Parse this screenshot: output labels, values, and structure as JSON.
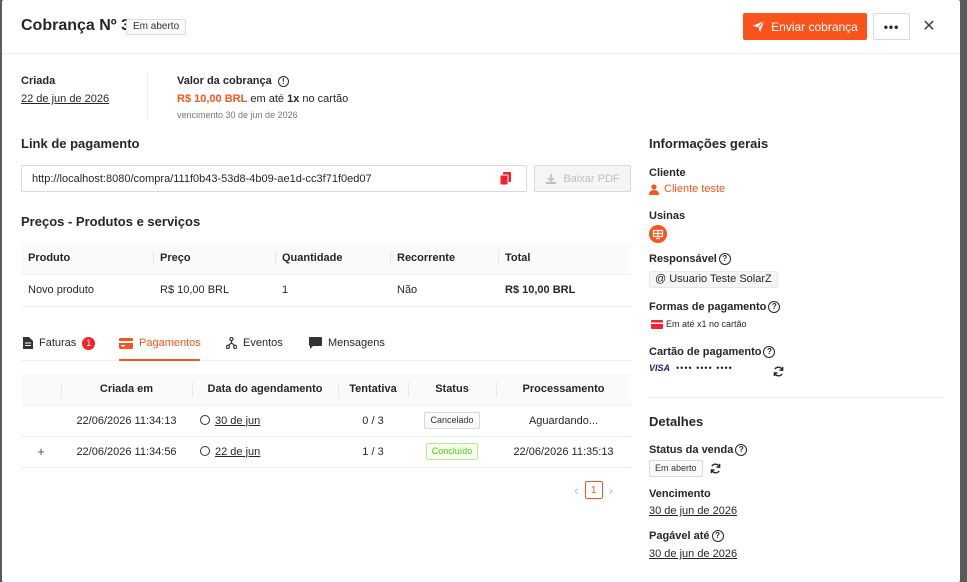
{
  "header": {
    "title": "Cobrança Nº 3",
    "status_badge": "Em aberto",
    "send_button": "Enviar cobrança",
    "more_button": "•••",
    "close_button": "✕"
  },
  "summary": {
    "created_label": "Criada",
    "created_date": "22 de jun de 2026",
    "value_label": "Valor da cobrança",
    "value_amount": "R$ 10,00 BRL",
    "value_mid": "em até",
    "value_installments": "1x",
    "value_suffix": "no cartão",
    "due_text": "vencimento 30 de jun de 2026"
  },
  "payment_link": {
    "title": "Link de pagamento",
    "url": "http://localhost:8080/compra/111f0b43-53d8-4b09-ae1d-cc3f71f0ed07",
    "pdf_button": "Baixar PDF"
  },
  "prices": {
    "title": "Preços - Produtos e serviços",
    "columns": [
      "Produto",
      "Preço",
      "Quantidade",
      "Recorrente",
      "Total"
    ],
    "rows": [
      [
        "Novo produto",
        "R$ 10,00 BRL",
        "1",
        "Não",
        "R$ 10,00 BRL"
      ]
    ]
  },
  "tabs": {
    "items": [
      {
        "label": "Faturas",
        "count": "1"
      },
      {
        "label": "Pagamentos"
      },
      {
        "label": "Eventos"
      },
      {
        "label": "Mensagens"
      }
    ],
    "active": "Pagamentos"
  },
  "payments": {
    "columns": [
      "Criada em",
      "Data do agendamento",
      "Tentativa",
      "Status",
      "Processamento"
    ],
    "rows": [
      {
        "expand": "",
        "created": "22/06/2026 11:34:13",
        "scheduled": "30 de jun",
        "attempt": "0 / 3",
        "status": "Cancelado",
        "processing": "Aguardando..."
      },
      {
        "expand": "+",
        "created": "22/06/2026 11:34:56",
        "scheduled": "22 de jun",
        "attempt": "1 / 3",
        "status": "Concluído",
        "processing": "22/06/2026 11:35:13"
      }
    ],
    "pager": {
      "prev": "‹",
      "current": "1",
      "next": "›"
    }
  },
  "info": {
    "title": "Informações gerais",
    "client_label": "Cliente",
    "client_value": "Cliente teste",
    "plants_label": "Usinas",
    "responsible_label": "Responsável",
    "responsible_value": "@ Usuario Teste SolarZ",
    "payment_forms_label": "Formas de pagamento",
    "payment_forms_value": "Em até x1 no cartão",
    "card_label": "Cartão de pagamento",
    "card_brand": "VISA",
    "card_mask": "•••• •••• ••••"
  },
  "details": {
    "title": "Detalhes",
    "sale_status_label": "Status da venda",
    "sale_status_value": "Em aberto",
    "due_label": "Vencimento",
    "due_value": "30 de jun de 2026",
    "payable_label": "Pagável até",
    "payable_value": "30 de jun de 2026"
  },
  "colors": {
    "accent": "#fa541c",
    "success": "#52c41a",
    "danger": "#f5222d"
  }
}
